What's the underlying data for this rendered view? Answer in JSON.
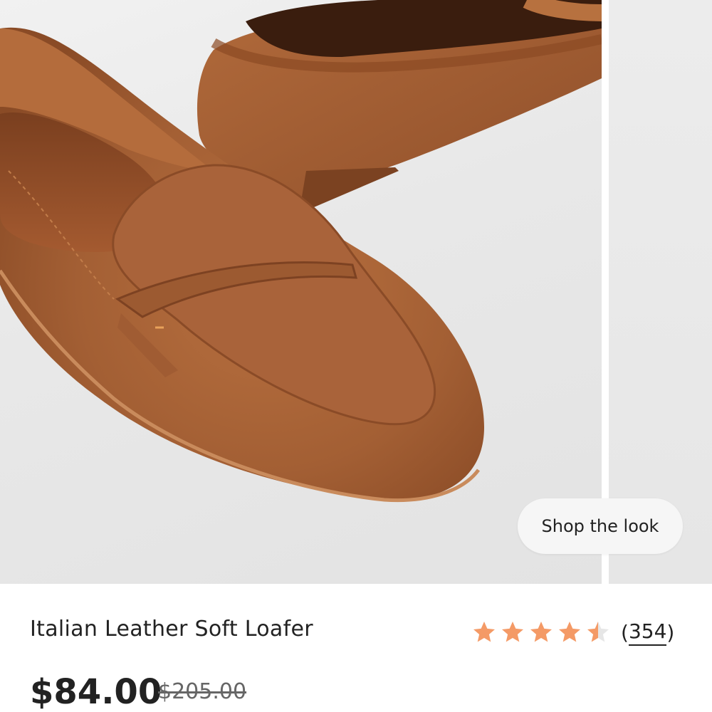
{
  "gallery": {
    "shop_the_look_label": "Shop the look"
  },
  "product": {
    "title": "Italian Leather Soft Loafer",
    "price": "$84.00",
    "original_price": "$205.00"
  },
  "rating": {
    "value": 4.5,
    "max": 5,
    "review_count_open": "(",
    "review_count": "354",
    "review_count_close": ")"
  },
  "colors": {
    "star": "#f49a66",
    "star_empty": "#e6e6e6",
    "text": "#222222",
    "leather": "#a35f34"
  }
}
